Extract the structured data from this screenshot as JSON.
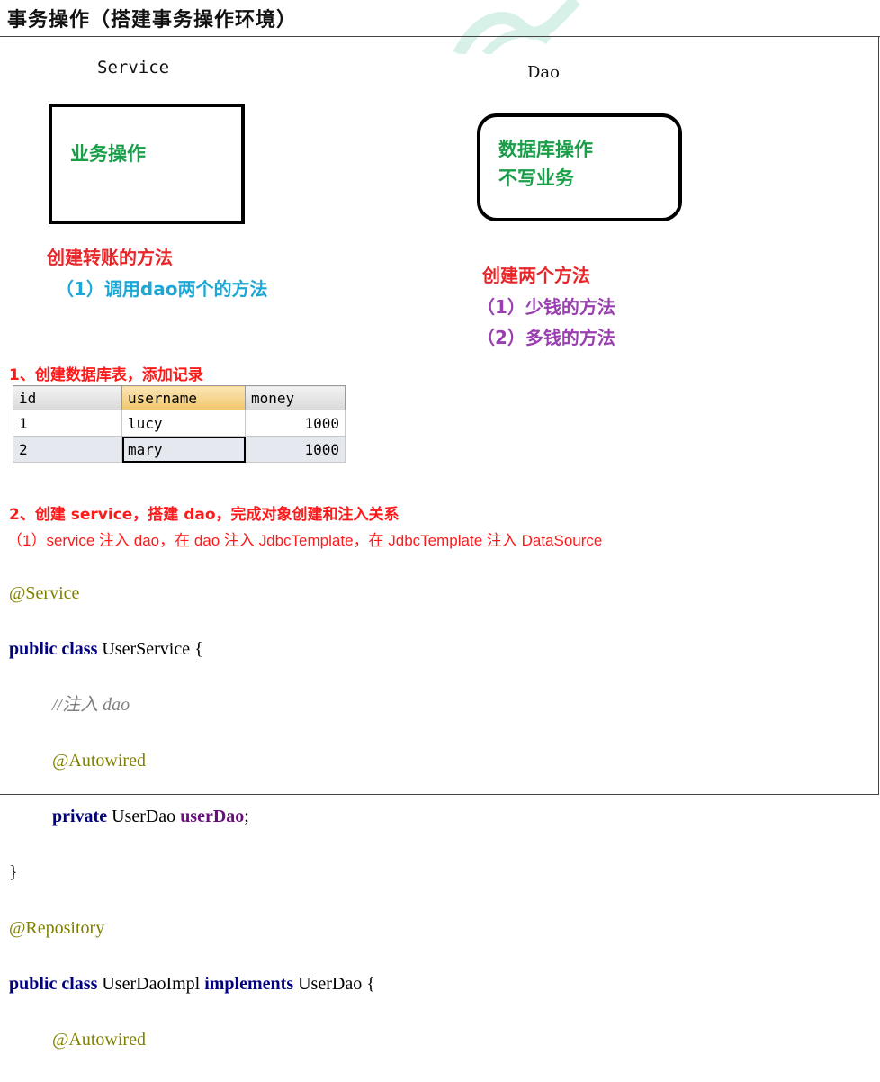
{
  "title": "事务操作（搭建事务操作环境）",
  "diagram": {
    "service_label": "Service",
    "dao_label": "Dao",
    "service_box_text": "业务操作",
    "dao_box_line1": "数据库操作",
    "dao_box_line2": "不写业务",
    "service_note_title": "创建转账的方法",
    "service_note_item": "（1）调用dao两个的方法",
    "dao_note_title": "创建两个方法",
    "dao_note_item1": "（1）少钱的方法",
    "dao_note_item2": "（2）多钱的方法"
  },
  "step1": "1、创建数据库表，添加记录",
  "table": {
    "columns": [
      "id",
      "username",
      "money"
    ],
    "rows": [
      [
        "1",
        "lucy",
        "1000"
      ],
      [
        "2",
        "mary",
        "1000"
      ]
    ]
  },
  "step2": "2、创建 service，搭建 dao，完成对象创建和注入关系",
  "step2_sub": "（1）service 注入 dao，在 dao 注入 JdbcTemplate，在 JdbcTemplate 注入 DataSource",
  "code": {
    "l1": "@Service",
    "l2_kw": "public class",
    "l2_rest": " UserService {",
    "l3": "//注入 dao",
    "l4": "@Autowired",
    "l5_kw": "private",
    "l5_type": " UserDao ",
    "l5_field": "userDao",
    "l5_end": ";",
    "l6": "}",
    "l7": "@Repository",
    "l8_kw1": "public class",
    "l8_mid": " UserDaoImpl ",
    "l8_kw2": "implements",
    "l8_end": " UserDao {",
    "l9": "@Autowired"
  }
}
